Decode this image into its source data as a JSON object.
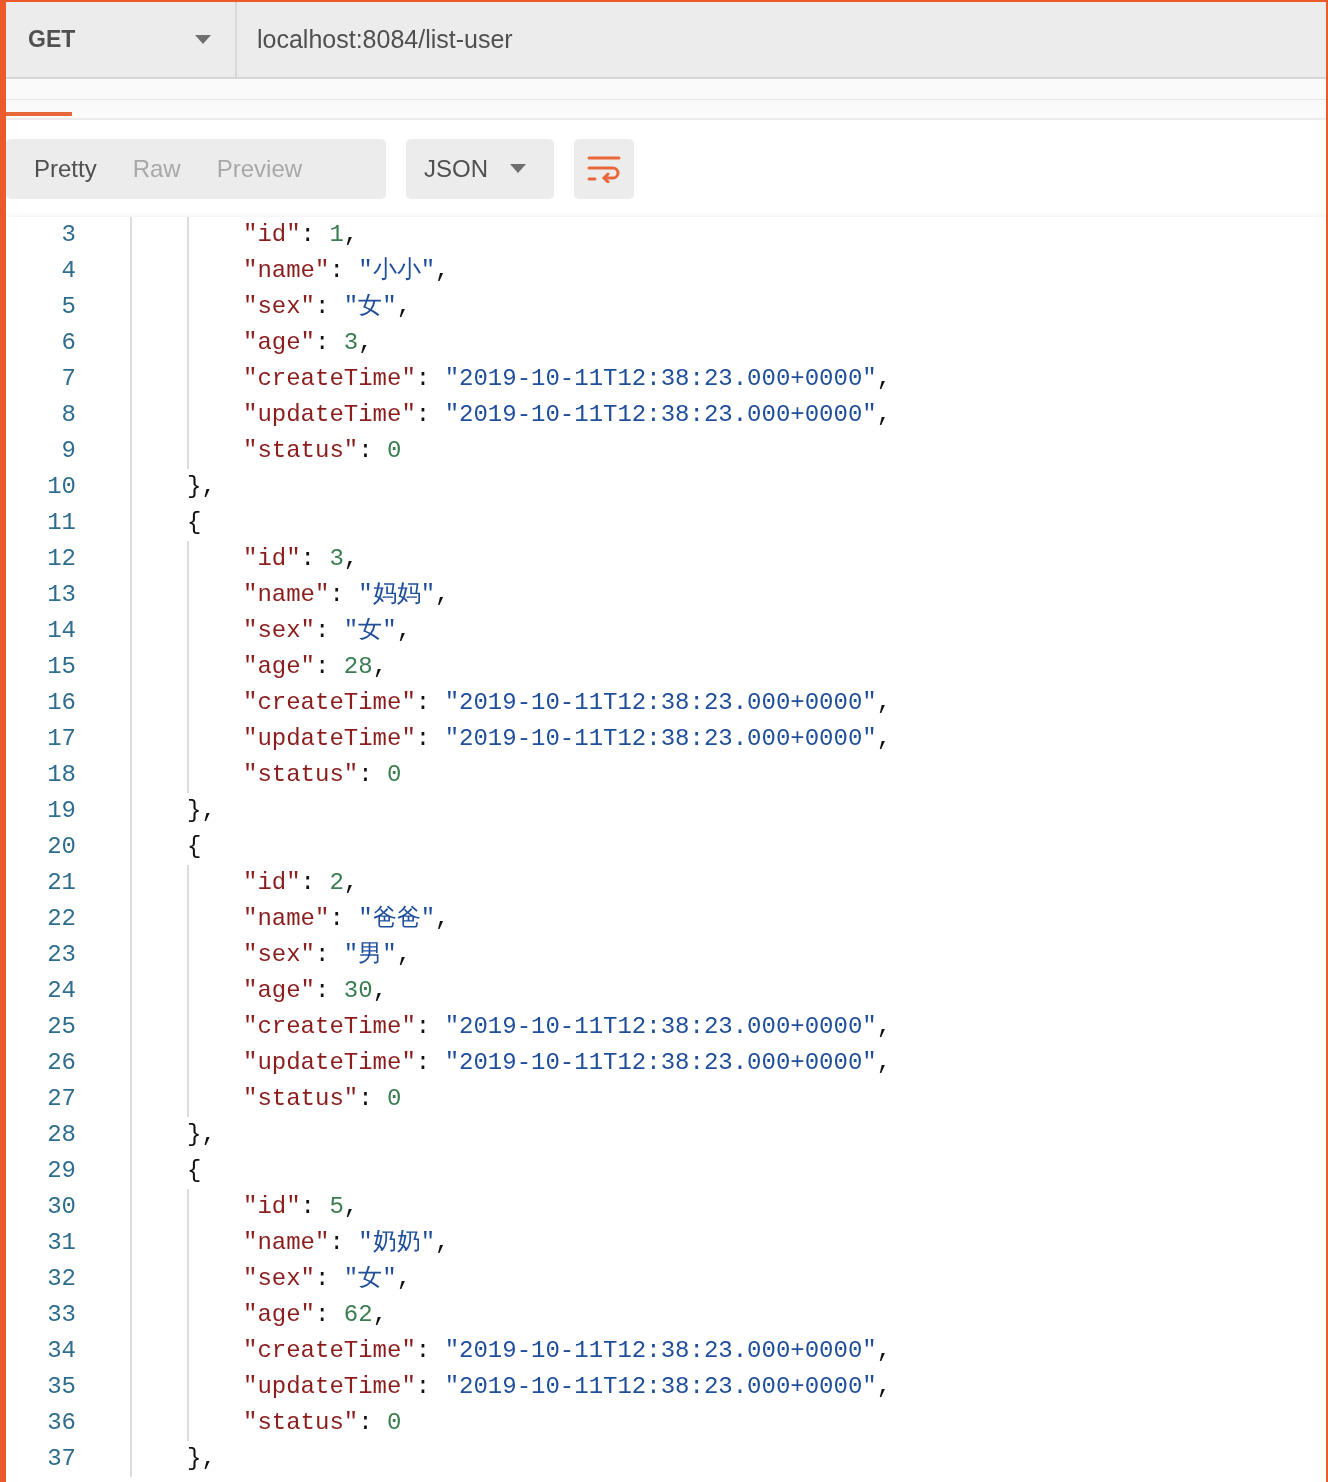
{
  "request": {
    "method": "GET",
    "url": "localhost:8084/list-user"
  },
  "view_tabs": [
    {
      "label": "Pretty",
      "selected": true
    },
    {
      "label": "Raw",
      "selected": false
    },
    {
      "label": "Preview",
      "selected": false
    }
  ],
  "format": {
    "label": "JSON"
  },
  "wrap": {
    "on": true
  },
  "lines": [
    {
      "number": "3",
      "kind": "field",
      "key": "\"id\"",
      "sep": ":",
      "value": {
        "kind": "number",
        "text": "1"
      },
      "trail": ","
    },
    {
      "number": "4",
      "kind": "field",
      "key": "\"name\"",
      "sep": ":",
      "value": {
        "kind": "string",
        "text": "\"小小\""
      },
      "trail": ","
    },
    {
      "number": "5",
      "kind": "field",
      "key": "\"sex\"",
      "sep": ":",
      "value": {
        "kind": "string",
        "text": "\"女\""
      },
      "trail": ","
    },
    {
      "number": "6",
      "kind": "field",
      "key": "\"age\"",
      "sep": ":",
      "value": {
        "kind": "number",
        "text": "3"
      },
      "trail": ","
    },
    {
      "number": "7",
      "kind": "field",
      "key": "\"createTime\"",
      "sep": ":",
      "value": {
        "kind": "string",
        "text": "\"2019-10-11T12:38:23.000+0000\""
      },
      "trail": ","
    },
    {
      "number": "8",
      "kind": "field",
      "key": "\"updateTime\"",
      "sep": ":",
      "value": {
        "kind": "string",
        "text": "\"2019-10-11T12:38:23.000+0000\""
      },
      "trail": ","
    },
    {
      "number": "9",
      "kind": "field",
      "key": "\"status\"",
      "sep": ":",
      "value": {
        "kind": "number",
        "text": "0"
      }
    },
    {
      "number": "10",
      "kind": "brace",
      "text": "},"
    },
    {
      "number": "11",
      "kind": "brace",
      "text": "{"
    },
    {
      "number": "12",
      "kind": "field",
      "key": "\"id\"",
      "sep": ":",
      "value": {
        "kind": "number",
        "text": "3"
      },
      "trail": ","
    },
    {
      "number": "13",
      "kind": "field",
      "key": "\"name\"",
      "sep": ":",
      "value": {
        "kind": "string",
        "text": "\"妈妈\""
      },
      "trail": ","
    },
    {
      "number": "14",
      "kind": "field",
      "key": "\"sex\"",
      "sep": ":",
      "value": {
        "kind": "string",
        "text": "\"女\""
      },
      "trail": ","
    },
    {
      "number": "15",
      "kind": "field",
      "key": "\"age\"",
      "sep": ":",
      "value": {
        "kind": "number",
        "text": "28"
      },
      "trail": ","
    },
    {
      "number": "16",
      "kind": "field",
      "key": "\"createTime\"",
      "sep": ":",
      "value": {
        "kind": "string",
        "text": "\"2019-10-11T12:38:23.000+0000\""
      },
      "trail": ","
    },
    {
      "number": "17",
      "kind": "field",
      "key": "\"updateTime\"",
      "sep": ":",
      "value": {
        "kind": "string",
        "text": "\"2019-10-11T12:38:23.000+0000\""
      },
      "trail": ","
    },
    {
      "number": "18",
      "kind": "field",
      "key": "\"status\"",
      "sep": ":",
      "value": {
        "kind": "number",
        "text": "0"
      }
    },
    {
      "number": "19",
      "kind": "brace",
      "text": "},"
    },
    {
      "number": "20",
      "kind": "brace",
      "text": "{"
    },
    {
      "number": "21",
      "kind": "field",
      "key": "\"id\"",
      "sep": ":",
      "value": {
        "kind": "number",
        "text": "2"
      },
      "trail": ","
    },
    {
      "number": "22",
      "kind": "field",
      "key": "\"name\"",
      "sep": ":",
      "value": {
        "kind": "string",
        "text": "\"爸爸\""
      },
      "trail": ","
    },
    {
      "number": "23",
      "kind": "field",
      "key": "\"sex\"",
      "sep": ":",
      "value": {
        "kind": "string",
        "text": "\"男\""
      },
      "trail": ","
    },
    {
      "number": "24",
      "kind": "field",
      "key": "\"age\"",
      "sep": ":",
      "value": {
        "kind": "number",
        "text": "30"
      },
      "trail": ","
    },
    {
      "number": "25",
      "kind": "field",
      "key": "\"createTime\"",
      "sep": ":",
      "value": {
        "kind": "string",
        "text": "\"2019-10-11T12:38:23.000+0000\""
      },
      "trail": ","
    },
    {
      "number": "26",
      "kind": "field",
      "key": "\"updateTime\"",
      "sep": ":",
      "value": {
        "kind": "string",
        "text": "\"2019-10-11T12:38:23.000+0000\""
      },
      "trail": ","
    },
    {
      "number": "27",
      "kind": "field",
      "key": "\"status\"",
      "sep": ":",
      "value": {
        "kind": "number",
        "text": "0"
      }
    },
    {
      "number": "28",
      "kind": "brace",
      "text": "},"
    },
    {
      "number": "29",
      "kind": "brace",
      "text": "{"
    },
    {
      "number": "30",
      "kind": "field",
      "key": "\"id\"",
      "sep": ":",
      "value": {
        "kind": "number",
        "text": "5"
      },
      "trail": ","
    },
    {
      "number": "31",
      "kind": "field",
      "key": "\"name\"",
      "sep": ":",
      "value": {
        "kind": "string",
        "text": "\"奶奶\""
      },
      "trail": ","
    },
    {
      "number": "32",
      "kind": "field",
      "key": "\"sex\"",
      "sep": ":",
      "value": {
        "kind": "string",
        "text": "\"女\""
      },
      "trail": ","
    },
    {
      "number": "33",
      "kind": "field",
      "key": "\"age\"",
      "sep": ":",
      "value": {
        "kind": "number",
        "text": "62"
      },
      "trail": ","
    },
    {
      "number": "34",
      "kind": "field",
      "key": "\"createTime\"",
      "sep": ":",
      "value": {
        "kind": "string",
        "text": "\"2019-10-11T12:38:23.000+0000\""
      },
      "trail": ","
    },
    {
      "number": "35",
      "kind": "field",
      "key": "\"updateTime\"",
      "sep": ":",
      "value": {
        "kind": "string",
        "text": "\"2019-10-11T12:38:23.000+0000\""
      },
      "trail": ","
    },
    {
      "number": "36",
      "kind": "field",
      "key": "\"status\"",
      "sep": ":",
      "value": {
        "kind": "number",
        "text": "0"
      }
    },
    {
      "number": "37",
      "kind": "brace",
      "text": "},"
    }
  ]
}
